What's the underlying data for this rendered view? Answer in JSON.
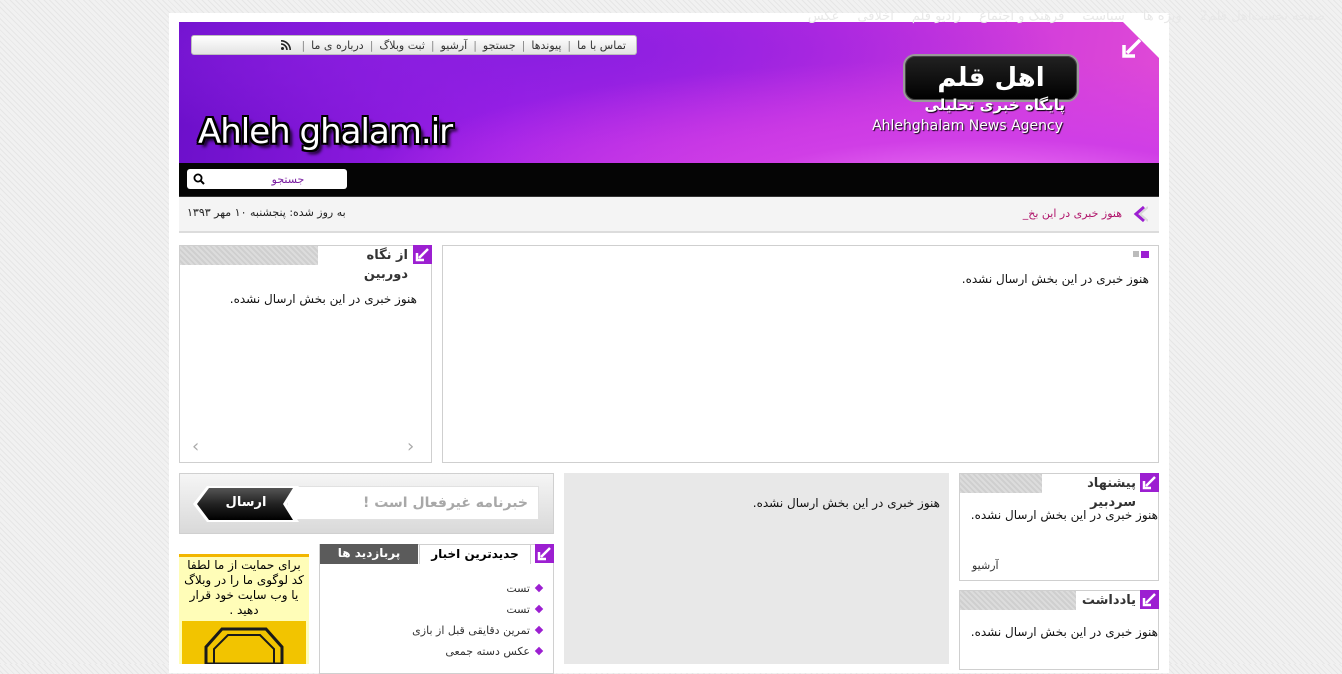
{
  "top_links": [
    "تماس با ما",
    "پیوندها",
    "جستجو",
    "آرشیو",
    "ثبت وبلاگ",
    "درباره ی ما"
  ],
  "rss_icon": "rss-icon",
  "logo": {
    "title": "اهل قلم",
    "subtitle": "پایگاه خبری تحلیلی",
    "english": "Ahlehghalam News Agency",
    "site_name": "Ahleh ghalam.ir"
  },
  "nav": [
    "صفحه نخست",
    "اهل قلم2",
    "ویژه ها",
    "سیاست",
    "فرهنگ و اجتماع",
    "رادیو قلم",
    "اخلاقی",
    "عکس"
  ],
  "search": {
    "placeholder": "جستجو"
  },
  "ticker": {
    "text": "هنوز خبری در این بخ_"
  },
  "date": "به روز شده: پنجشنبه ۱۰ مهر ۱۳۹۳",
  "main_slider": {
    "empty": "هنوز خبری در این بخش ارسال نشده."
  },
  "camera_box": {
    "title": "از نگاه دوربین",
    "empty": "هنوز خبری در این بخش ارسال نشده.",
    "prev": "‹",
    "next": "›"
  },
  "newsletter": {
    "placeholder": "خبرنامه غیرفعال است !",
    "button": "ارسال"
  },
  "middle_box": {
    "empty": "هنوز خبری در این بخش ارسال نشده."
  },
  "tabs": {
    "active": "جدیدترین اخبار",
    "inactive": "پربازدید ها"
  },
  "latest_news": [
    "تست",
    "تست",
    "تمرین دقایقی قبل از بازی",
    "عکس دسته جمعی"
  ],
  "ad": {
    "text": "برای حمایت از ما لطفا کد لوگوی ما را در وبلاگ یا وب سایت خود قرار دهید ."
  },
  "editor_box": {
    "title": "پیشنهاد سردبیر",
    "empty": "هنوز خبری در این بخش ارسال نشده.",
    "archive": "آرشیو"
  },
  "notes_box": {
    "title": "یادداشت",
    "empty": "هنوز خبری در این بخش ارسال نشده."
  },
  "colors": {
    "accent": "#9c1fd1",
    "nav_bg": "#050505",
    "ticker_text": "#b0156b"
  }
}
